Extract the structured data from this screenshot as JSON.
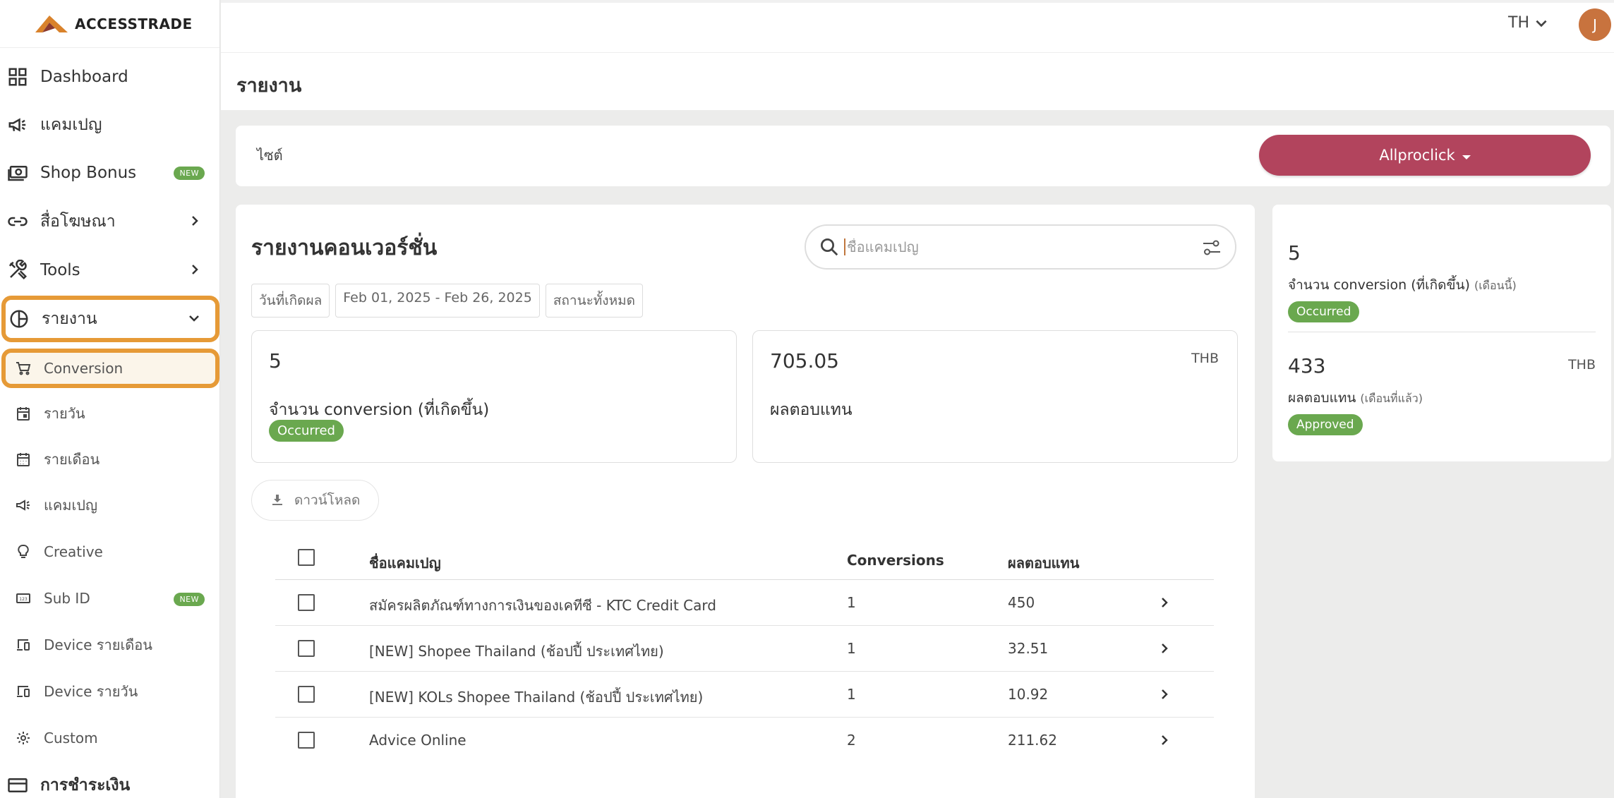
{
  "brand": {
    "name": "ACCESSTRADE",
    "accent": "#b2445d",
    "highlight": "#e69a37",
    "success": "#6aa84f"
  },
  "sidebar": {
    "items": [
      {
        "label": "Dashboard",
        "icon": "grid-icon"
      },
      {
        "label": "แคมเปญ",
        "icon": "megaphone-icon"
      },
      {
        "label": "Shop Bonus",
        "icon": "cash-icon",
        "badge": "NEW"
      },
      {
        "label": "สื่อโฆษณา",
        "icon": "link-icon"
      },
      {
        "label": "Tools",
        "icon": "tools-icon"
      },
      {
        "label": "รายงาน",
        "icon": "pie-chart-icon"
      }
    ],
    "subitems": [
      {
        "label": "Conversion",
        "icon": "cart-icon"
      },
      {
        "label": "รายวัน",
        "icon": "calendar-day-icon"
      },
      {
        "label": "รายเดือน",
        "icon": "calendar-month-icon"
      },
      {
        "label": "แคมเปญ",
        "icon": "megaphone-icon"
      },
      {
        "label": "Creative",
        "icon": "lightbulb-icon"
      },
      {
        "label": "Sub ID",
        "icon": "sub-id-icon",
        "badge": "NEW"
      },
      {
        "label": "Device รายเดือน",
        "icon": "devices-icon"
      },
      {
        "label": "Device รายวัน",
        "icon": "devices-icon"
      },
      {
        "label": "Custom",
        "icon": "custom-gear-icon"
      }
    ],
    "cutoff_label": "การชำระเงิน"
  },
  "topbar": {
    "language": "TH",
    "avatar_initial": "J"
  },
  "page": {
    "title": "รายงาน"
  },
  "site": {
    "label": "ไซต์",
    "selected": "Allproclick"
  },
  "report": {
    "title": "รายงานคอนเวอร์ชั่น",
    "search_placeholder": "ชื่อแคมเปญ",
    "filters": [
      "วันที่เกิดผล",
      "Feb 01, 2025 - Feb 26, 2025",
      "สถานะทั้งหมด"
    ],
    "stats": [
      {
        "value": "5",
        "currency": "",
        "label": "จำนวน conversion (ที่เกิดขึ้น)",
        "status": "Occurred"
      },
      {
        "value": "705.05",
        "currency": "THB",
        "label": "ผลตอบแทน",
        "status": ""
      }
    ],
    "download_label": "ดาวน์โหลด",
    "table": {
      "headers": {
        "name": "ชื่อแคมเปญ",
        "conversions": "Conversions",
        "commission": "ผลตอบแทน"
      },
      "rows": [
        {
          "name": "สมัครผลิตภัณฑ์ทางการเงินของเคทีซี - KTC Credit Card",
          "conversions": "1",
          "commission": "450"
        },
        {
          "name": "[NEW] Shopee Thailand (ช้อปปี้ ประเทศไทย)",
          "conversions": "1",
          "commission": "32.51"
        },
        {
          "name": "[NEW] KOLs Shopee Thailand (ช้อปปี้ ประเทศไทย)",
          "conversions": "1",
          "commission": "10.92"
        },
        {
          "name": "Advice Online",
          "conversions": "2",
          "commission": "211.62"
        }
      ]
    }
  },
  "summary": {
    "current": {
      "value": "5",
      "label": "จำนวน conversion (ที่เกิดขึ้น)",
      "note": "(เดือนนี้)",
      "status": "Occurred"
    },
    "previous": {
      "value": "433",
      "currency": "THB",
      "label": "ผลตอบแทน",
      "note": "(เดือนที่แล้ว)",
      "status": "Approved"
    }
  }
}
